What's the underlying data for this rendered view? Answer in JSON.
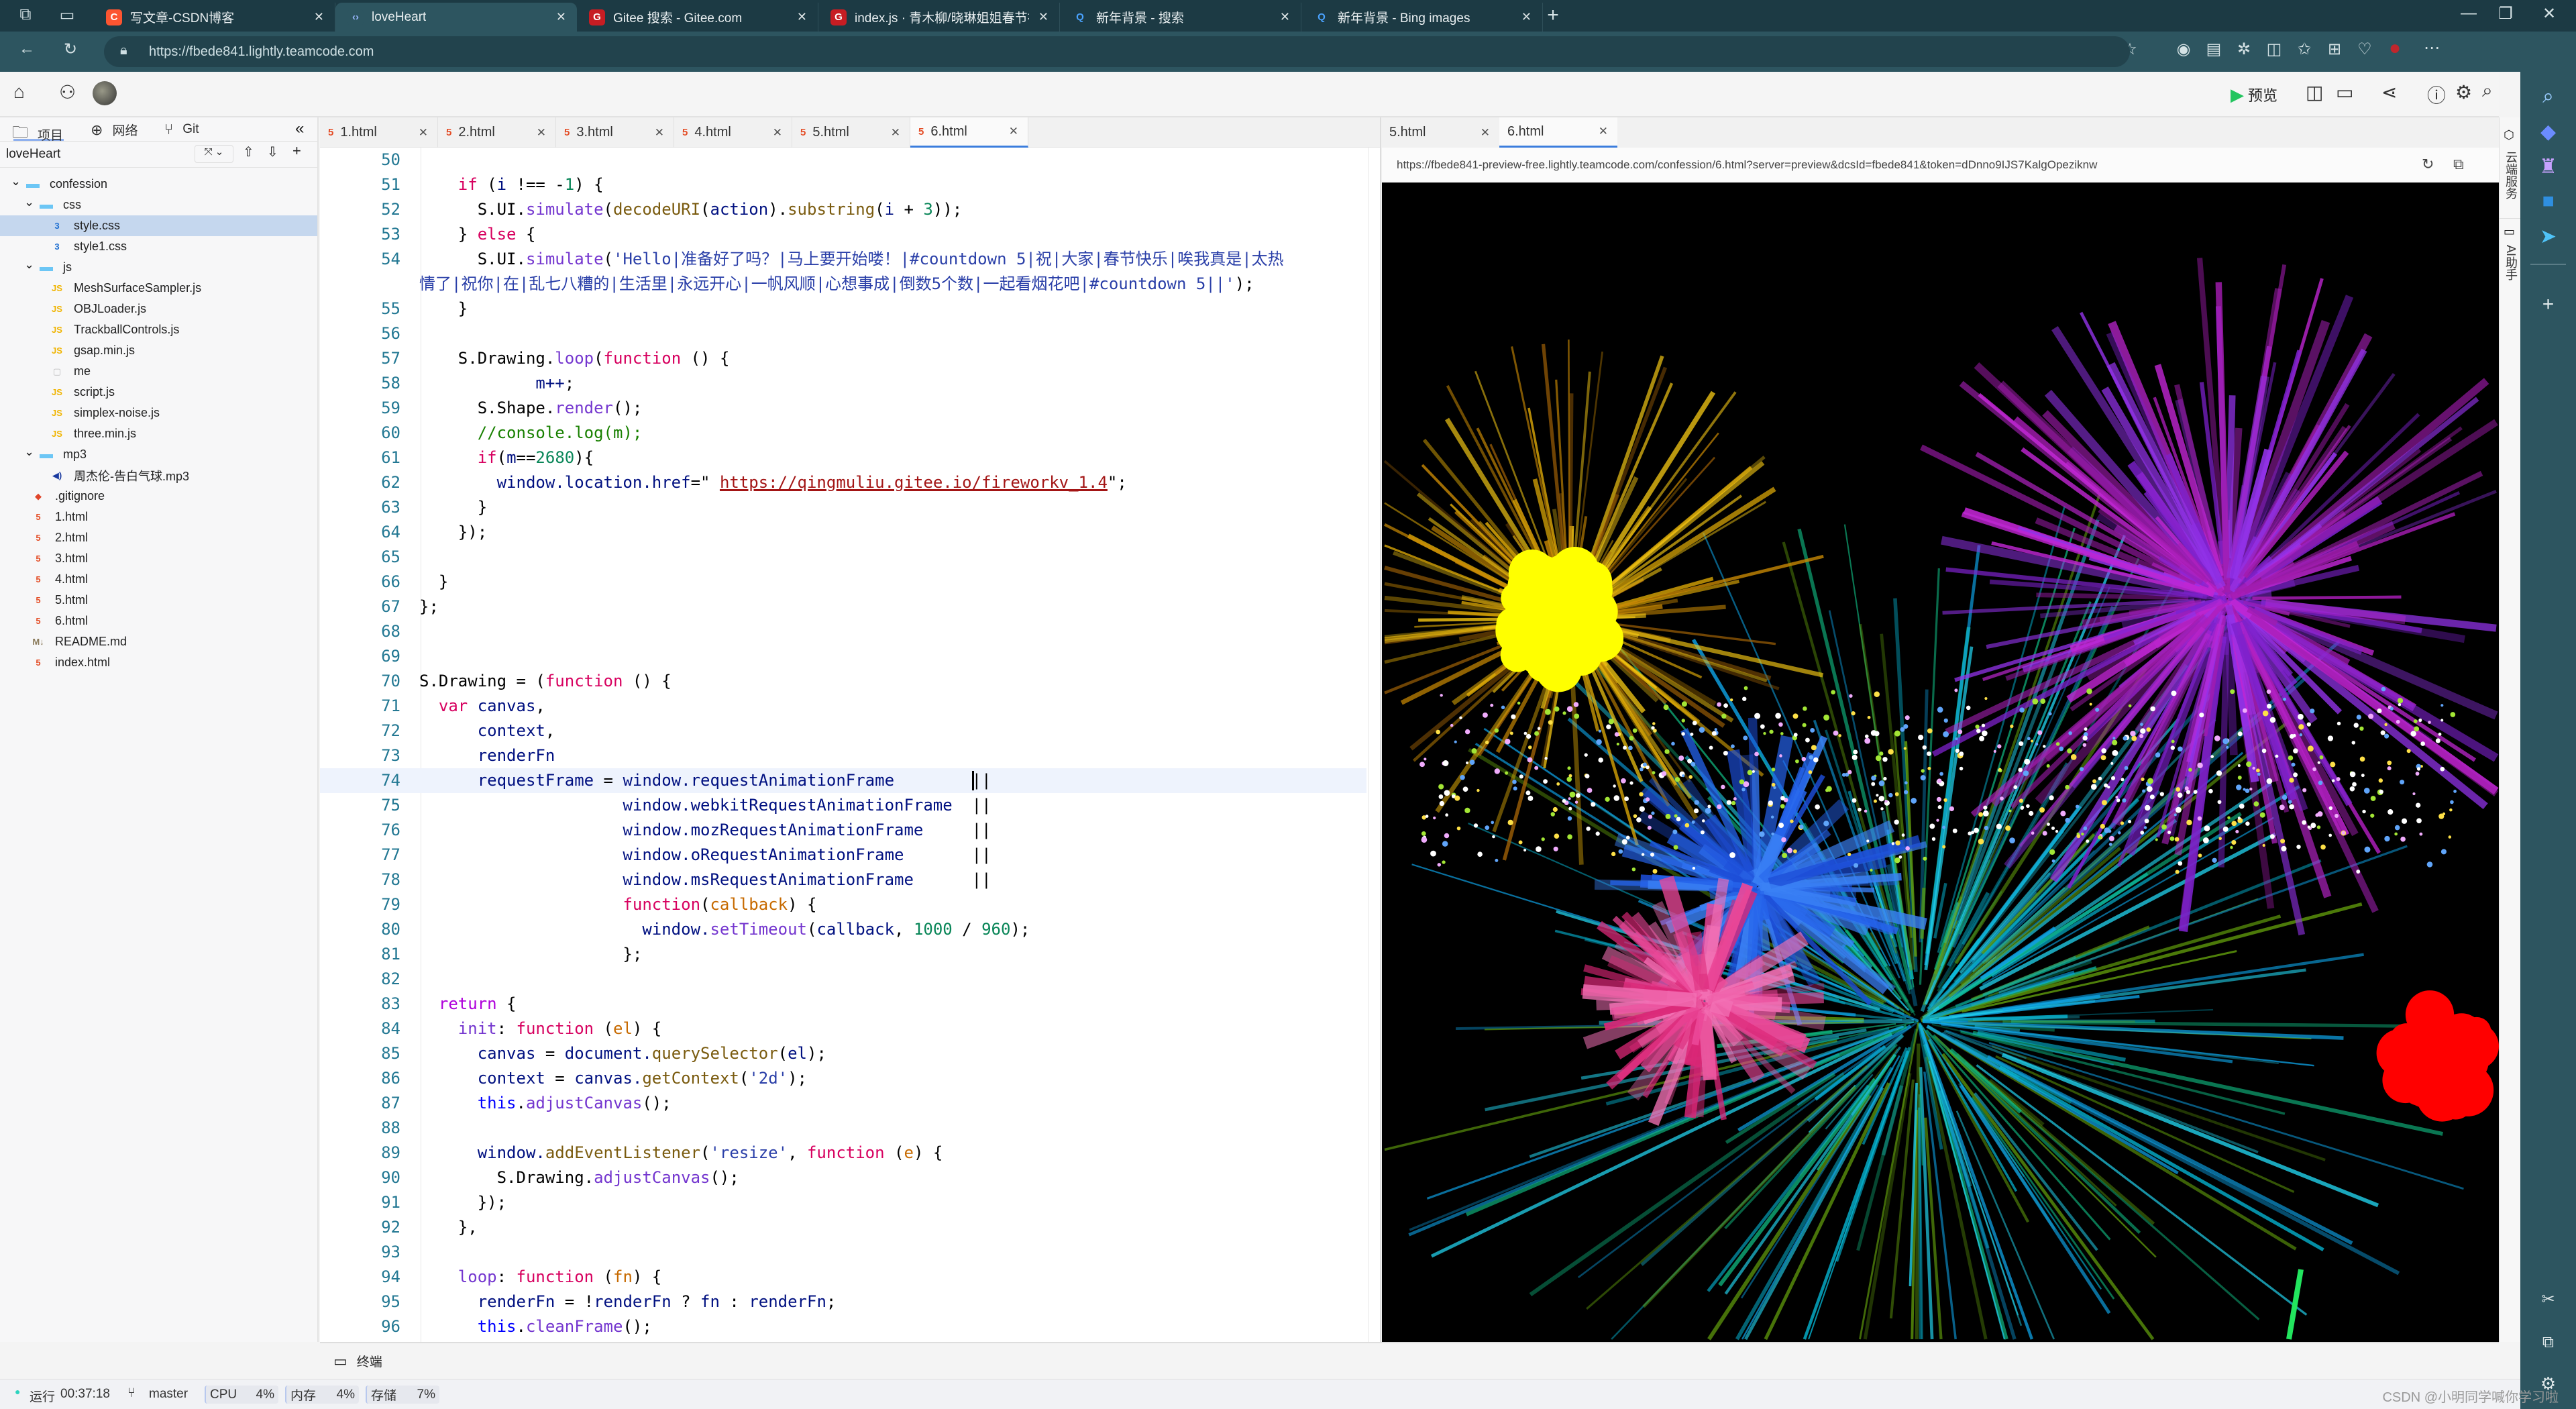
{
  "browser": {
    "tabs": [
      {
        "title": "写文章-CSDN博客",
        "icon": "csdn-icon",
        "color": "#fc5531",
        "glyph": "C"
      },
      {
        "title": "loveHeart",
        "icon": "teamcode-icon",
        "color": "#2d5560",
        "glyph": "‹›",
        "active": true
      },
      {
        "title": "Gitee 搜索 - Gitee.com",
        "icon": "gitee-icon",
        "color": "#c71d23",
        "glyph": "G"
      },
      {
        "title": "index.js · 青木柳/晓琳姐姐春节祝福",
        "icon": "gitee-icon",
        "color": "#c71d23",
        "glyph": "G"
      },
      {
        "title": "新年背景 - 搜索",
        "icon": "bing-search-icon",
        "color": "#1c3a44",
        "glyph": "Q"
      },
      {
        "title": "新年背景 - Bing images",
        "icon": "bing-search-icon",
        "color": "#1c3a44",
        "glyph": "Q"
      }
    ],
    "url": "https://fbede841.lightly.teamcode.com"
  },
  "ide": {
    "panel_tabs": {
      "project": "项目",
      "network": "网络",
      "git": "Git"
    },
    "project_name": "loveHeart",
    "tree": [
      {
        "label": "confession",
        "type": "folder",
        "depth": 0
      },
      {
        "label": "css",
        "type": "folder",
        "depth": 1
      },
      {
        "label": "style.css",
        "type": "css",
        "depth": 2,
        "selected": true
      },
      {
        "label": "style1.css",
        "type": "css",
        "depth": 2
      },
      {
        "label": "js",
        "type": "folder",
        "depth": 1
      },
      {
        "label": "MeshSurfaceSampler.js",
        "type": "js",
        "depth": 2
      },
      {
        "label": "OBJLoader.js",
        "type": "js",
        "depth": 2
      },
      {
        "label": "TrackballControls.js",
        "type": "js",
        "depth": 2
      },
      {
        "label": "gsap.min.js",
        "type": "js",
        "depth": 2
      },
      {
        "label": "me",
        "type": "file",
        "depth": 2
      },
      {
        "label": "script.js",
        "type": "js",
        "depth": 2
      },
      {
        "label": "simplex-noise.js",
        "type": "js",
        "depth": 2
      },
      {
        "label": "three.min.js",
        "type": "js",
        "depth": 2
      },
      {
        "label": "mp3",
        "type": "folder",
        "depth": 1
      },
      {
        "label": "周杰伦-告白气球.mp3",
        "type": "audio",
        "depth": 2
      },
      {
        "label": ".gitignore",
        "type": "git",
        "depth": 1
      },
      {
        "label": "1.html",
        "type": "html",
        "depth": 1
      },
      {
        "label": "2.html",
        "type": "html",
        "depth": 1
      },
      {
        "label": "3.html",
        "type": "html",
        "depth": 1
      },
      {
        "label": "4.html",
        "type": "html",
        "depth": 1
      },
      {
        "label": "5.html",
        "type": "html",
        "depth": 1
      },
      {
        "label": "6.html",
        "type": "html",
        "depth": 1
      },
      {
        "label": "README.md",
        "type": "md",
        "depth": 1
      },
      {
        "label": "index.html",
        "type": "html",
        "depth": 1
      }
    ],
    "editor_tabs": [
      "1.html",
      "2.html",
      "3.html",
      "4.html",
      "5.html",
      "6.html"
    ],
    "active_editor_tab": "6.html",
    "current_line": 74,
    "code": [
      {
        "n": 50,
        "t": []
      },
      {
        "n": 51,
        "t": [
          [
            "p",
            "    "
          ],
          [
            "k",
            "if"
          ],
          [
            "p",
            " ("
          ],
          [
            "v",
            "i"
          ],
          [
            "p",
            " !== -"
          ],
          [
            "n",
            "1"
          ],
          [
            "p",
            ") {"
          ]
        ]
      },
      {
        "n": 52,
        "t": [
          [
            "p",
            "      S.UI."
          ],
          [
            "f",
            "simulate"
          ],
          [
            "p",
            "("
          ],
          [
            "m",
            "decodeURI"
          ],
          [
            "p",
            "("
          ],
          [
            "v",
            "action"
          ],
          [
            "p",
            ")."
          ],
          [
            "m",
            "substring"
          ],
          [
            "p",
            "("
          ],
          [
            "v",
            "i"
          ],
          [
            "p",
            " + "
          ],
          [
            "n",
            "3"
          ],
          [
            "p",
            "));"
          ]
        ]
      },
      {
        "n": 53,
        "t": [
          [
            "p",
            "    } "
          ],
          [
            "k",
            "else"
          ],
          [
            "p",
            " {"
          ]
        ]
      },
      {
        "n": 54,
        "t": [
          [
            "p",
            "      S.UI."
          ],
          [
            "f",
            "simulate"
          ],
          [
            "p",
            "("
          ],
          [
            "s",
            "'Hello|准备好了吗？|马上要开始喽！|#countdown 5|祝|大家|春节快乐|唉我真是|太热"
          ]
        ]
      },
      {
        "n": "",
        "t": [
          [
            "s",
            "情了|祝你|在|乱七八糟的|生活里|永远开心|一帆风顺|心想事成|倒数5个数|一起看烟花吧|#countdown 5||'"
          ],
          [
            "p",
            ");"
          ]
        ],
        "wrap": true
      },
      {
        "n": 55,
        "t": [
          [
            "p",
            "    }"
          ]
        ]
      },
      {
        "n": 56,
        "t": []
      },
      {
        "n": 57,
        "t": [
          [
            "p",
            "    S.Drawing."
          ],
          [
            "f",
            "loop"
          ],
          [
            "p",
            "("
          ],
          [
            "k",
            "function"
          ],
          [
            "p",
            " () {"
          ]
        ]
      },
      {
        "n": 58,
        "t": [
          [
            "v",
            "            m++"
          ],
          [
            "p",
            ";"
          ]
        ]
      },
      {
        "n": 59,
        "t": [
          [
            "p",
            "      S.Shape."
          ],
          [
            "f",
            "render"
          ],
          [
            "p",
            "();"
          ]
        ]
      },
      {
        "n": 60,
        "t": [
          [
            "p",
            "      "
          ],
          [
            "c",
            "//console.log(m);"
          ]
        ]
      },
      {
        "n": 61,
        "t": [
          [
            "p",
            "      "
          ],
          [
            "k",
            "if"
          ],
          [
            "p",
            "("
          ],
          [
            "v",
            "m"
          ],
          [
            "p",
            "=="
          ],
          [
            "n",
            "2680"
          ],
          [
            "p",
            "){"
          ]
        ]
      },
      {
        "n": 62,
        "t": [
          [
            "v",
            "        window.location.href"
          ],
          [
            "p",
            "=\" "
          ],
          [
            "u",
            "https://qingmuliu.gitee.io/fireworkv_1.4"
          ],
          [
            "p",
            "\";"
          ]
        ]
      },
      {
        "n": 63,
        "t": [
          [
            "p",
            "      }"
          ]
        ]
      },
      {
        "n": 64,
        "t": [
          [
            "p",
            "    });"
          ]
        ]
      },
      {
        "n": 65,
        "t": []
      },
      {
        "n": 66,
        "t": [
          [
            "p",
            "  }"
          ]
        ]
      },
      {
        "n": 67,
        "t": [
          [
            "p",
            "};"
          ]
        ]
      },
      {
        "n": 68,
        "t": []
      },
      {
        "n": 69,
        "t": []
      },
      {
        "n": 70,
        "t": [
          [
            "p",
            "S.Drawing = ("
          ],
          [
            "k",
            "function"
          ],
          [
            "p",
            " () {"
          ]
        ]
      },
      {
        "n": 71,
        "t": [
          [
            "p",
            "  "
          ],
          [
            "k",
            "var"
          ],
          [
            "v",
            " canvas"
          ],
          [
            "p",
            ","
          ]
        ]
      },
      {
        "n": 72,
        "t": [
          [
            "v",
            "      context"
          ],
          [
            "p",
            ","
          ]
        ]
      },
      {
        "n": 73,
        "t": [
          [
            "v",
            "      renderFn"
          ]
        ]
      },
      {
        "n": 74,
        "t": [
          [
            "v",
            "      requestFrame"
          ],
          [
            "p",
            " = "
          ],
          [
            "v",
            "window.requestAnimationFrame"
          ],
          [
            "p",
            "        ||"
          ]
        ]
      },
      {
        "n": 75,
        "t": [
          [
            "v",
            "                     window.webkitRequestAnimationFrame"
          ],
          [
            "p",
            "  ||"
          ]
        ]
      },
      {
        "n": 76,
        "t": [
          [
            "v",
            "                     window.mozRequestAnimationFrame"
          ],
          [
            "p",
            "     ||"
          ]
        ]
      },
      {
        "n": 77,
        "t": [
          [
            "v",
            "                     window.oRequestAnimationFrame"
          ],
          [
            "p",
            "       ||"
          ]
        ]
      },
      {
        "n": 78,
        "t": [
          [
            "v",
            "                     window.msRequestAnimationFrame"
          ],
          [
            "p",
            "      ||"
          ]
        ]
      },
      {
        "n": 79,
        "t": [
          [
            "p",
            "                     "
          ],
          [
            "k",
            "function"
          ],
          [
            "p",
            "("
          ],
          [
            "a",
            "callback"
          ],
          [
            "p",
            ") {"
          ]
        ]
      },
      {
        "n": 80,
        "t": [
          [
            "v",
            "                       window."
          ],
          [
            "f",
            "setTimeout"
          ],
          [
            "p",
            "("
          ],
          [
            "v",
            "callback"
          ],
          [
            "p",
            ", "
          ],
          [
            "n",
            "1000"
          ],
          [
            "p",
            " / "
          ],
          [
            "n",
            "960"
          ],
          [
            "p",
            ");"
          ]
        ]
      },
      {
        "n": 81,
        "t": [
          [
            "p",
            "                     };"
          ]
        ]
      },
      {
        "n": 82,
        "t": []
      },
      {
        "n": 83,
        "t": [
          [
            "p",
            "  "
          ],
          [
            "r",
            "return"
          ],
          [
            "p",
            " {"
          ]
        ]
      },
      {
        "n": 84,
        "t": [
          [
            "p",
            "    "
          ],
          [
            "f",
            "init"
          ],
          [
            "p",
            ": "
          ],
          [
            "k",
            "function"
          ],
          [
            "p",
            " ("
          ],
          [
            "a",
            "el"
          ],
          [
            "p",
            ") {"
          ]
        ]
      },
      {
        "n": 85,
        "t": [
          [
            "v",
            "      canvas"
          ],
          [
            "p",
            " = "
          ],
          [
            "v",
            "document."
          ],
          [
            "m",
            "querySelector"
          ],
          [
            "p",
            "("
          ],
          [
            "v",
            "el"
          ],
          [
            "p",
            ");"
          ]
        ]
      },
      {
        "n": 86,
        "t": [
          [
            "v",
            "      context"
          ],
          [
            "p",
            " = "
          ],
          [
            "v",
            "canvas."
          ],
          [
            "m",
            "getContext"
          ],
          [
            "p",
            "("
          ],
          [
            "s",
            "'2d'"
          ],
          [
            "p",
            ");"
          ]
        ]
      },
      {
        "n": 87,
        "t": [
          [
            "p",
            "      "
          ],
          [
            "t",
            "this"
          ],
          [
            "p",
            "."
          ],
          [
            "f",
            "adjustCanvas"
          ],
          [
            "p",
            "();"
          ]
        ]
      },
      {
        "n": 88,
        "t": []
      },
      {
        "n": 89,
        "t": [
          [
            "v",
            "      window."
          ],
          [
            "m",
            "addEventListener"
          ],
          [
            "p",
            "("
          ],
          [
            "s",
            "'resize'"
          ],
          [
            "p",
            ", "
          ],
          [
            "k",
            "function"
          ],
          [
            "p",
            " ("
          ],
          [
            "a",
            "e"
          ],
          [
            "p",
            ") {"
          ]
        ]
      },
      {
        "n": 90,
        "t": [
          [
            "p",
            "        S.Drawing."
          ],
          [
            "f",
            "adjustCanvas"
          ],
          [
            "p",
            "();"
          ]
        ]
      },
      {
        "n": 91,
        "t": [
          [
            "p",
            "      });"
          ]
        ]
      },
      {
        "n": 92,
        "t": [
          [
            "p",
            "    },"
          ]
        ]
      },
      {
        "n": 93,
        "t": []
      },
      {
        "n": 94,
        "t": [
          [
            "p",
            "    "
          ],
          [
            "f",
            "loop"
          ],
          [
            "p",
            ": "
          ],
          [
            "k",
            "function"
          ],
          [
            "p",
            " ("
          ],
          [
            "a",
            "fn"
          ],
          [
            "p",
            ") {"
          ]
        ]
      },
      {
        "n": 95,
        "t": [
          [
            "v",
            "      renderFn"
          ],
          [
            "p",
            " = !"
          ],
          [
            "v",
            "renderFn"
          ],
          [
            "p",
            " ? "
          ],
          [
            "v",
            "fn"
          ],
          [
            "p",
            " : "
          ],
          [
            "v",
            "renderFn"
          ],
          [
            "p",
            ";"
          ]
        ]
      },
      {
        "n": 96,
        "t": [
          [
            "p",
            "      "
          ],
          [
            "t",
            "this"
          ],
          [
            "p",
            "."
          ],
          [
            "f",
            "cleanFrame"
          ],
          [
            "p",
            "();"
          ]
        ]
      }
    ],
    "toolbar": {
      "preview_label": "预览"
    },
    "preview": {
      "tabs": [
        "5.html",
        "6.html"
      ],
      "active_tab": "6.html",
      "url": "https://fbede841-preview-free.lightly.teamcode.com/confession/6.html?server=preview&dcsId=fbede841&token=dDnno9IJS7KalgOpeziknw"
    },
    "side_strip": {
      "cloud": "云端服务",
      "ai": "AI助手"
    },
    "terminal_label": "终端",
    "status": {
      "run_label": "运行",
      "run_time": "00:37:18",
      "branch": "master",
      "cpu_label": "CPU",
      "cpu": "4%",
      "mem_label": "内存",
      "mem": "4%",
      "storage_label": "存储",
      "storage": "7%"
    }
  },
  "watermark": "CSDN @小明同学喊你学习啦",
  "colors": {
    "accent": "#3b7ddd",
    "run_green": "#22c55e",
    "browser_frame": "#2d5560"
  }
}
